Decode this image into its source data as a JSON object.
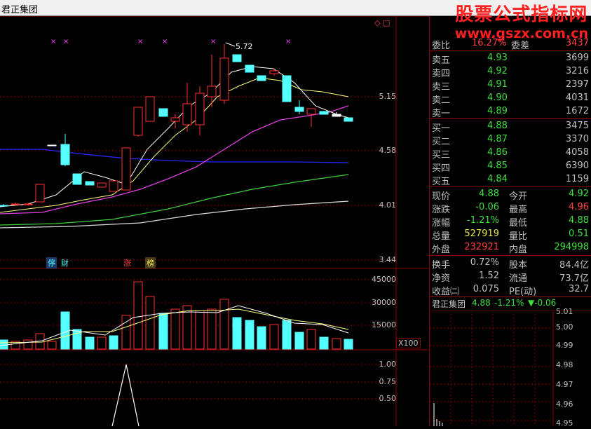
{
  "window": {
    "title": "君正集团",
    "buttons": "◇ □"
  },
  "watermark": {
    "line1": "股票公式指标网",
    "line2": "www.gszx.com.cn"
  },
  "axes": {
    "price_ticks": [
      "5.15",
      "4.58",
      "4.01",
      "3.44"
    ],
    "volume_ticks": [
      "45000",
      "30000",
      "15000"
    ],
    "volume_unit": "X100",
    "indicator_ticks": [
      "1.00",
      "0.75",
      "0.50"
    ],
    "mini_ticks": [
      "5.01",
      "5.00",
      "4.99",
      "4.98",
      "4.97",
      "4.96",
      "4.95"
    ]
  },
  "annotations": {
    "high_label": "5.72",
    "tags": [
      "停",
      "财",
      "涨",
      "榜"
    ]
  },
  "quote": {
    "header": {
      "label1": "委比",
      "val1": "16.27%",
      "label2": "委差",
      "val2": "3437"
    },
    "asks": [
      {
        "label": "卖五",
        "price": "4.93",
        "vol": "3699"
      },
      {
        "label": "卖四",
        "price": "4.92",
        "vol": "3216"
      },
      {
        "label": "卖三",
        "price": "4.91",
        "vol": "2397"
      },
      {
        "label": "卖二",
        "price": "4.90",
        "vol": "4031"
      },
      {
        "label": "卖一",
        "price": "4.89",
        "vol": "1672"
      }
    ],
    "bids": [
      {
        "label": "买一",
        "price": "4.88",
        "vol": "3475"
      },
      {
        "label": "买二",
        "price": "4.87",
        "vol": "3370"
      },
      {
        "label": "买三",
        "price": "4.86",
        "vol": "4058"
      },
      {
        "label": "买四",
        "price": "4.85",
        "vol": "6390"
      },
      {
        "label": "买五",
        "price": "4.84",
        "vol": "1159"
      }
    ],
    "stats": [
      {
        "l1": "现价",
        "v1": "4.88",
        "c1": "#3fdf3f",
        "l2": "今开",
        "v2": "4.92",
        "c2": "#3fdf3f"
      },
      {
        "l1": "涨跌",
        "v1": "-0.06",
        "c1": "#3fdf3f",
        "l2": "最高",
        "v2": "4.96",
        "c2": "#ff4040"
      },
      {
        "l1": "涨幅",
        "v1": "-1.21%",
        "c1": "#3fdf3f",
        "l2": "最低",
        "v2": "4.88",
        "c2": "#3fdf3f"
      },
      {
        "l1": "总量",
        "v1": "527919",
        "c1": "#e8e84a",
        "l2": "量比",
        "v2": "0.51",
        "c2": "#3fdf3f"
      },
      {
        "l1": "外盘",
        "v1": "232921",
        "c1": "#ff4040",
        "l2": "内盘",
        "v2": "294998",
        "c2": "#3fdf3f"
      }
    ],
    "fund": [
      {
        "l1": "换手",
        "v1": "0.72%",
        "l2": "股本",
        "v2": "84.4亿"
      },
      {
        "l1": "净资",
        "v1": "1.52",
        "l2": "流通",
        "v2": "73.7亿"
      },
      {
        "l1": "收益㈡",
        "v1": "0.075",
        "l2": "PE(动)",
        "v2": "32.7"
      }
    ],
    "mini_header": {
      "name": "君正集团",
      "price": "4.88",
      "pct": "-1.21%",
      "chg": "▼-0.06"
    }
  },
  "colors": {
    "up": "#ff3030",
    "down": "#54ffff",
    "green": "#3fdf3f",
    "red": "#ff4040"
  }
}
